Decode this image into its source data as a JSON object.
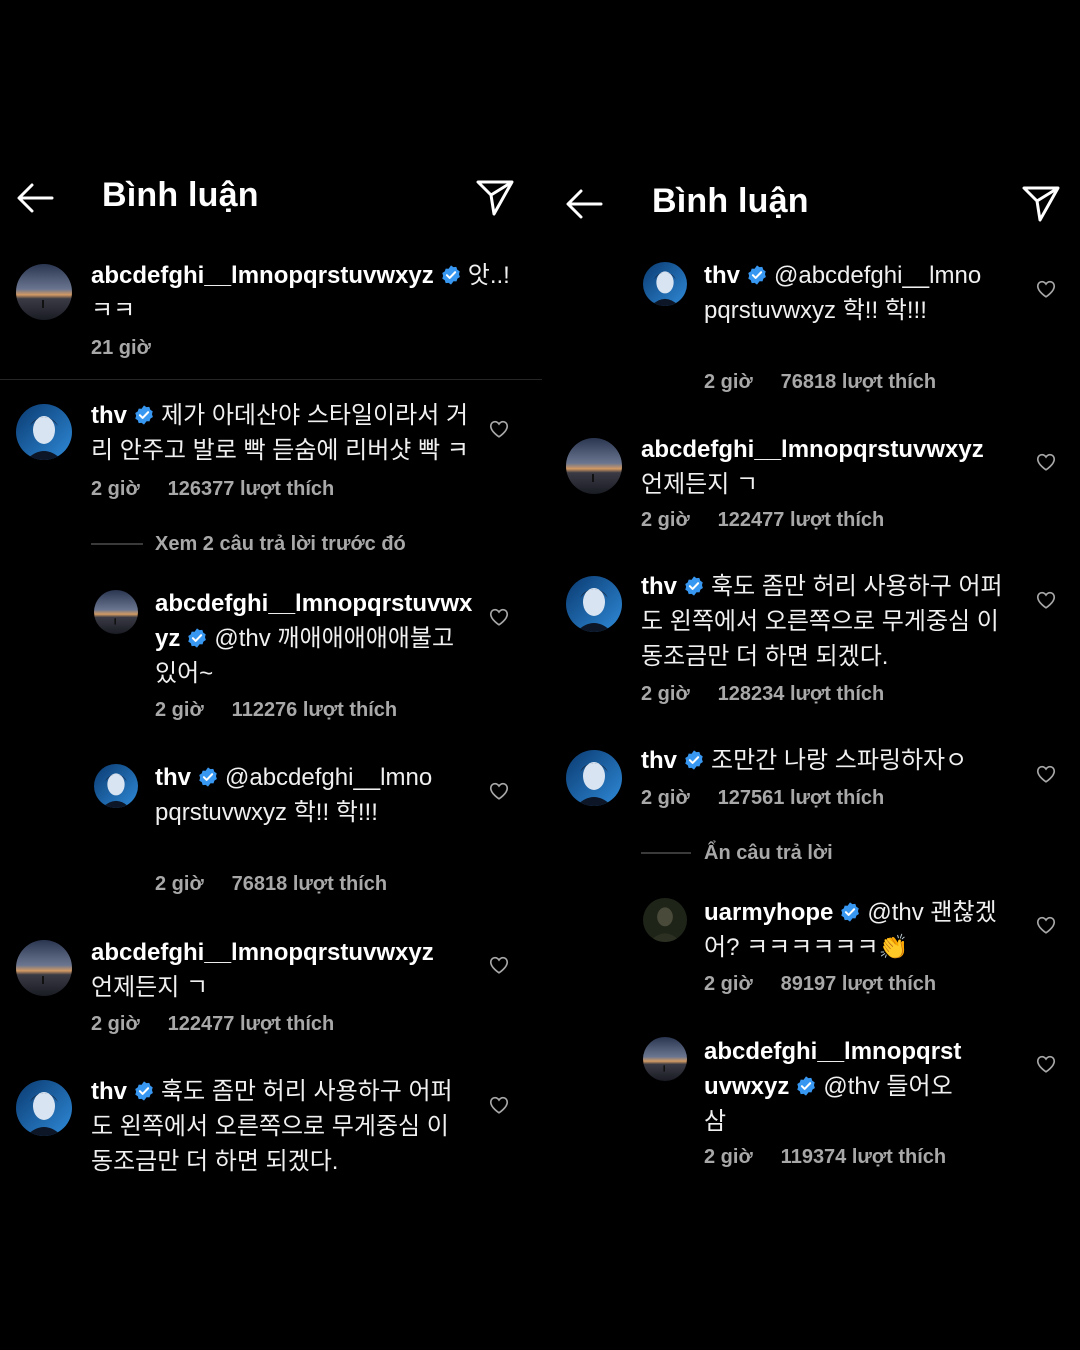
{
  "header": {
    "title": "Bình luận"
  },
  "left": {
    "comments": [
      {
        "user": "abcdefghi__lmnopqrstuvwxyz",
        "text": "앗..! ㅋㅋ",
        "time": "21 giờ"
      },
      {
        "user": "thv",
        "text": "제가 아데산야 스타일이라서 거리 안주고 발로 빡 듣숨에 리버샷 빡 ㅋ",
        "time": "2 giờ",
        "likes": "126377 lượt thích"
      },
      {
        "user": "abcdefghi__lmnopqrstuvwxyz",
        "text": "@thv 깨애애애애애불고 있어~",
        "time": "2 giờ",
        "likes": "112276 lượt thích"
      },
      {
        "user": "thv",
        "text": "@abcdefghi__lmnopqrstuvwxyz 학!! 학!!!",
        "time": "2 giờ",
        "likes": "76818 lượt thích"
      },
      {
        "user": "abcdefghi__lmnopqrstuvwxyz",
        "text": "언제든지 ㄱ",
        "time": "2 giờ",
        "likes": "122477 lượt thích"
      },
      {
        "user": "thv",
        "text": "훅도 좀만 허리 사용하구 어퍼도 왼쪽에서 오른쪽으로 무게중심 이동조금만 더 하면 되겠다."
      }
    ],
    "view_replies": "Xem 2 câu trả lời trước đó"
  },
  "right": {
    "comments": [
      {
        "user": "thv",
        "text": "@abcdefghi__lmnopqrstuvwxyz 학!! 학!!!",
        "time": "2 giờ",
        "likes": "76818 lượt thích"
      },
      {
        "user": "abcdefghi__lmnopqrstuvwxyz",
        "text": "언제든지 ㄱ",
        "time": "2 giờ",
        "likes": "122477 lượt thích"
      },
      {
        "user": "thv",
        "text": "훅도 좀만 허리 사용하구 어퍼도 왼쪽에서 오른쪽으로 무게중심 이동조금만 더 하면 되겠다.",
        "time": "2 giờ",
        "likes": "128234 lượt thích"
      },
      {
        "user": "thv",
        "text": "조만간 나랑 스파링하자ㅇ",
        "time": "2 giờ",
        "likes": "127561 lượt thích"
      },
      {
        "user": "uarmyhope",
        "text": "@thv 괜찮겠어? ㅋㅋㅋㅋㅋㅋ👏",
        "time": "2 giờ",
        "likes": "89197 lượt thích"
      },
      {
        "user": "abcdefghi__lmnopqrstuvwxyz",
        "text": "@thv 들어오삼",
        "time": "2 giờ",
        "likes": "119374 lượt thích"
      }
    ],
    "hide_replies": "Ẩn câu trả lời"
  },
  "colors": {
    "background": "#000000",
    "verified": "#3897f0",
    "secondary_text": "#a8a8a8"
  }
}
